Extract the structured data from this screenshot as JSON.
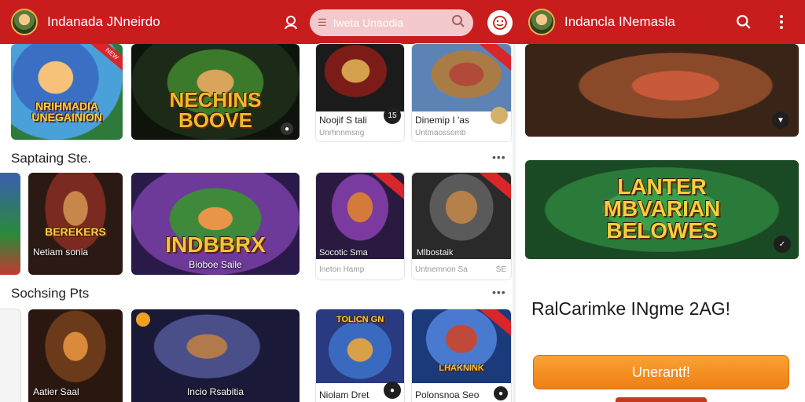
{
  "header": {
    "left_title": "Indanada JNneirdo",
    "search_placeholder": "Iweta Unaodia",
    "right_title": "Indancla INemasla"
  },
  "featured": [
    {
      "art_text": "NRIHMADIA UNEGAINION",
      "ribbon": "NEW"
    },
    {
      "art_text": "NECHINS BOOVE",
      "caption": ""
    }
  ],
  "top_tiles": [
    {
      "title": "Noojif S tali",
      "subtitle": "Unrhnnmsng",
      "badge": "15"
    },
    {
      "title": "Dinemip I 'as",
      "subtitle": "Untmaossomb",
      "badge": ""
    }
  ],
  "sections": [
    {
      "title": "Saptaing Ste.",
      "more": "•••",
      "cards": [
        {
          "art_text": "BEREKERS",
          "caption": "Netiam sonia"
        },
        {
          "art_text": "INDBBRX",
          "caption": "Bioboe Saile"
        }
      ],
      "tiles": [
        {
          "art_text": "",
          "title": "Socotic Sma",
          "subtitle": "Ineton Hamp",
          "badge": ""
        },
        {
          "art_text": "",
          "title": "Mlbostaik",
          "subtitle": "Untnemnon Sa",
          "badge": "SE"
        }
      ]
    },
    {
      "title": "Sochsing Pts",
      "more": "•••",
      "cards": [
        {
          "art_text": "",
          "caption": "Aatier Saal"
        },
        {
          "art_text": "",
          "caption": "Incio Rsabitia"
        }
      ],
      "tiles": [
        {
          "art_text": "TOLICN GN",
          "title": "Niolam Dret",
          "subtitle": "",
          "badge": ""
        },
        {
          "art_text": "LHAKNINK",
          "title": "Polonsnoa Seo",
          "subtitle": "",
          "badge": ""
        }
      ]
    }
  ],
  "right_panel": {
    "banner_text": "LANTER MBVARIAN BELOWES",
    "promo_text": "RalCarimke INgme 2AG!",
    "cta_label": "Unerantf!"
  }
}
